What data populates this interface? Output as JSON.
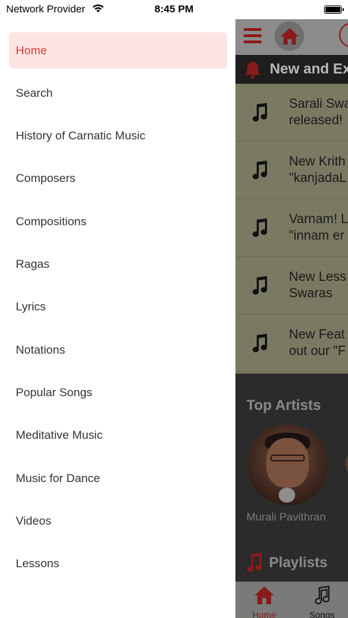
{
  "status_bar": {
    "carrier": "Network Provider",
    "time": "8:45 PM"
  },
  "drawer": {
    "items": [
      {
        "label": "Home",
        "active": true
      },
      {
        "label": "Search"
      },
      {
        "label": "History of Carnatic Music"
      },
      {
        "label": "Composers"
      },
      {
        "label": "Compositions"
      },
      {
        "label": "Ragas"
      },
      {
        "label": "Lyrics"
      },
      {
        "label": "Notations"
      },
      {
        "label": "Popular Songs"
      },
      {
        "label": "Meditative Music"
      },
      {
        "label": "Music for Dance"
      },
      {
        "label": "Videos"
      },
      {
        "label": "Lessons"
      }
    ]
  },
  "app": {
    "news_title": "New and Ex",
    "news_items": [
      {
        "text": "Sarali Swa\nreleased!"
      },
      {
        "text": "New Krith\n\"kanjadaL"
      },
      {
        "text": "Varnam! L\n\"innam er"
      },
      {
        "text": "New Less\nSwaras"
      },
      {
        "text": "New Feat\nout our \"F"
      }
    ],
    "top_artists_title": "Top Artists",
    "artist_name": "Murali Pavithran",
    "playlists_title": "Playlists",
    "tabs": {
      "home": "Home",
      "songs": "Songs"
    }
  },
  "colors": {
    "accent": "#e53935",
    "active_bg": "#fde4e4",
    "brand_dark_red": "#8b1a1a"
  },
  "icons": [
    "wifi-icon",
    "battery-icon",
    "hamburger-icon",
    "home-icon",
    "bell-icon",
    "music-note-icon"
  ]
}
